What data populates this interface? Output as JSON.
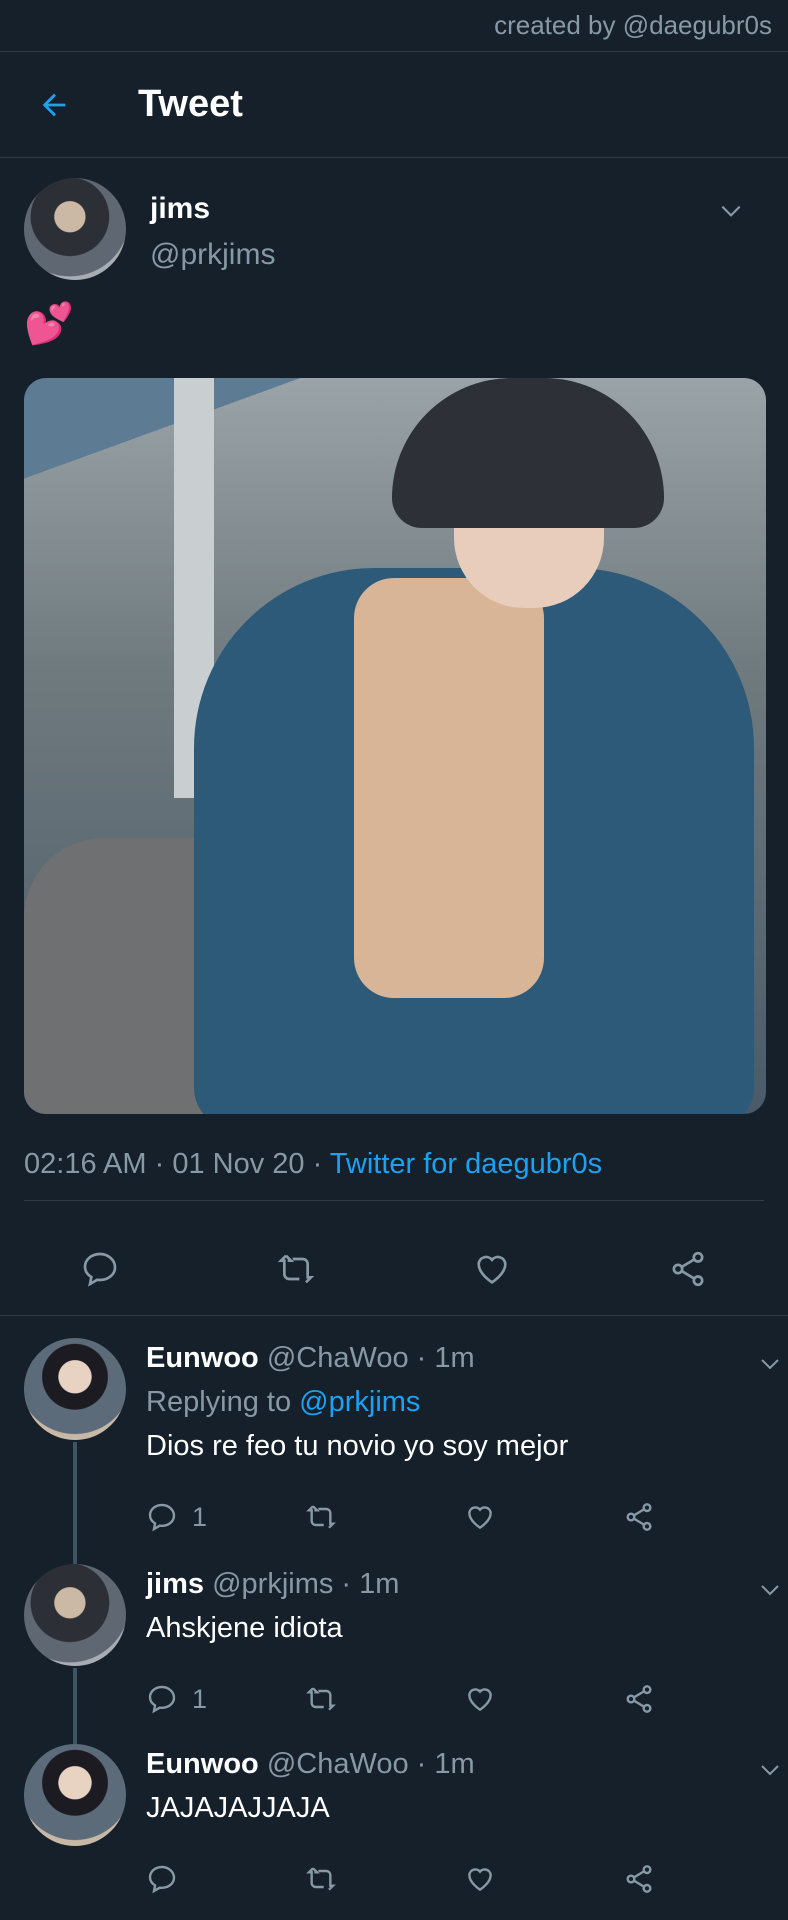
{
  "credit": "created by @daegubr0s",
  "header": {
    "title": "Tweet"
  },
  "tweet": {
    "name": "jims",
    "handle": "@prkjims",
    "text": "💕",
    "time": "02:16 AM",
    "sep1": " · ",
    "date": "01 Nov 20",
    "sep2": " · ",
    "source": "Twitter for daegubr0s"
  },
  "replies": [
    {
      "name": "Eunwoo",
      "handle": "@ChaWoo",
      "sep": " · ",
      "time": "1m",
      "replying_prefix": "Replying to ",
      "replying_to": "@prkjims",
      "text": "Dios re feo tu novio yo soy mejor",
      "reply_count": "1"
    },
    {
      "name": "jims",
      "handle": "@prkjims",
      "sep": " · ",
      "time": "1m",
      "text": "Ahskjene idiota",
      "reply_count": "1"
    },
    {
      "name": "Eunwoo",
      "handle": "@ChaWoo",
      "sep": " · ",
      "time": "1m",
      "text": "JAJAJAJJAJA",
      "reply_count": ""
    }
  ],
  "colors": {
    "accent": "#1da1f2",
    "background": "#15202b",
    "muted": "#8899a6"
  }
}
